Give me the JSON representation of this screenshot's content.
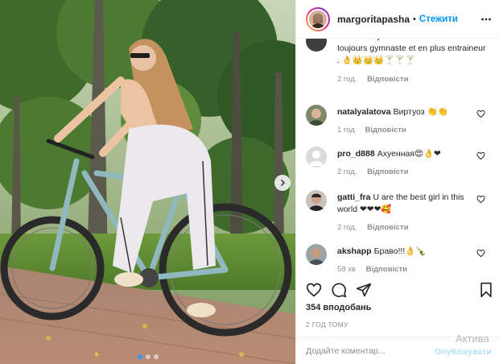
{
  "post": {
    "username": "margoritapasha",
    "separator": "•",
    "follow_label": "Стежити",
    "more_icon": "more-horizontal-icon"
  },
  "caption_partial": {
    "text": "avec vous j'ai une de mes filles est toujours gymnaste et en plus entraineur . 👌👑👑👑🍸🍸🍸",
    "time": "2 год.",
    "reply_label": "Відповісти"
  },
  "comments": [
    {
      "username": "natalyalatova",
      "text": "Виртуоз 👏👏",
      "time": "1 год",
      "reply_label": "Відповісти"
    },
    {
      "username": "pro_d888",
      "text": "Ахуенная😍👌❤",
      "time": "2 год.",
      "reply_label": "Відповісти"
    },
    {
      "username": "gatti_fra",
      "text": "U are the best girl in this world ❤❤❤🥰",
      "time": "2 год.",
      "reply_label": "Відповісти"
    },
    {
      "username": "akshapp",
      "text": "Браво!!!👌🍾",
      "time": "58 хв",
      "reply_label": "Відповісти"
    }
  ],
  "likes_text": "354 вподобань",
  "timestamp": "2 ГОД ТОМУ",
  "add_comment": {
    "placeholder": "Додайте коментар...",
    "publish_label": "Опублікувати"
  },
  "watermark": "Актива",
  "colors": {
    "accent": "#0095f6",
    "meta": "#8e8e8e",
    "liked_dot": "#3897f0"
  }
}
